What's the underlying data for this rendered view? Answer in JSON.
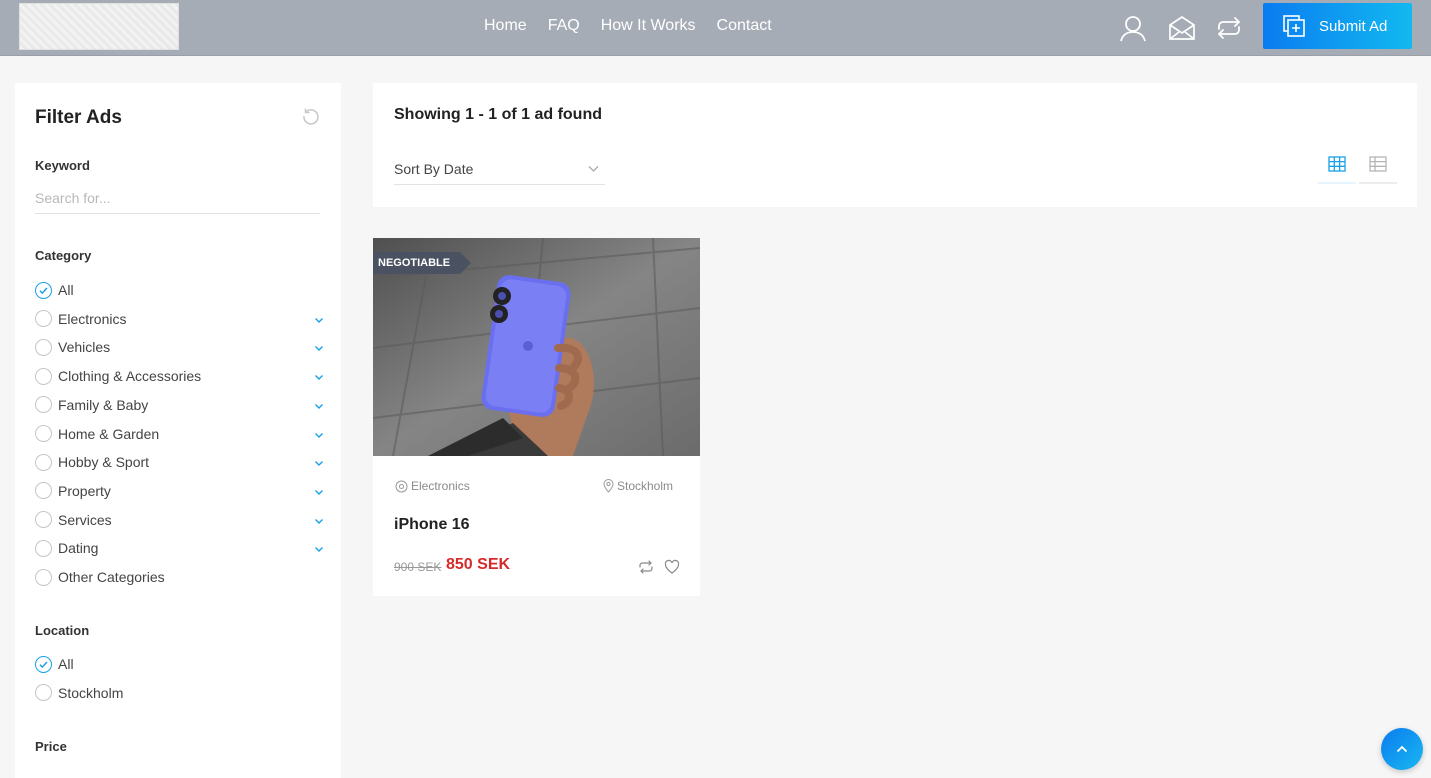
{
  "header": {
    "nav": [
      "Home",
      "FAQ",
      "How It Works",
      "Contact"
    ],
    "icons": [
      "user-icon",
      "envelope-icon",
      "compare-icon"
    ],
    "submit_label": "Submit Ad"
  },
  "sidebar": {
    "title": "Filter Ads",
    "keyword": {
      "label": "Keyword",
      "placeholder": "Search for..."
    },
    "category": {
      "label": "Category",
      "options": [
        {
          "label": "All",
          "checked": true,
          "expandable": false
        },
        {
          "label": "Electronics",
          "checked": false,
          "expandable": true
        },
        {
          "label": "Vehicles",
          "checked": false,
          "expandable": true
        },
        {
          "label": "Clothing & Accessories",
          "checked": false,
          "expandable": true
        },
        {
          "label": "Family & Baby",
          "checked": false,
          "expandable": true
        },
        {
          "label": "Home & Garden",
          "checked": false,
          "expandable": true
        },
        {
          "label": "Hobby & Sport",
          "checked": false,
          "expandable": true
        },
        {
          "label": "Property",
          "checked": false,
          "expandable": true
        },
        {
          "label": "Services",
          "checked": false,
          "expandable": true
        },
        {
          "label": "Dating",
          "checked": false,
          "expandable": true
        },
        {
          "label": "Other Categories",
          "checked": false,
          "expandable": false
        }
      ]
    },
    "location": {
      "label": "Location",
      "options": [
        {
          "label": "All",
          "checked": true
        },
        {
          "label": "Stockholm",
          "checked": false
        }
      ]
    },
    "price": {
      "label": "Price"
    }
  },
  "results": {
    "count_text": "Showing 1 - 1 of 1 ad found",
    "sort_value": "Sort By Date",
    "view_mode": "grid"
  },
  "ad": {
    "badge": "NEGOTIABLE",
    "category": "Electronics",
    "location": "Stockholm",
    "title": "iPhone 16",
    "old_price": "900 SEK",
    "price": "850 SEK"
  },
  "colors": {
    "accent": "#1aa0e8",
    "price": "#d62a2a",
    "header": "#a6acb6"
  }
}
